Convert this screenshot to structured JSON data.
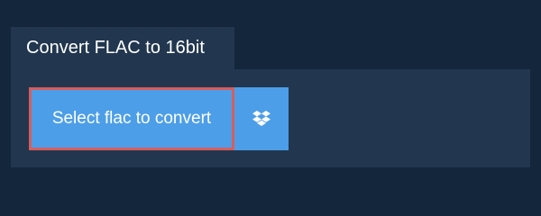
{
  "header": {
    "tab_title": "Convert FLAC to 16bit"
  },
  "uploader": {
    "select_label": "Select flac to convert",
    "dropbox_icon": "dropbox-icon"
  },
  "colors": {
    "background": "#13263b",
    "panel": "#22374f",
    "button": "#4c9ee8",
    "highlight_border": "#d55e5e",
    "text": "#ffffff"
  }
}
